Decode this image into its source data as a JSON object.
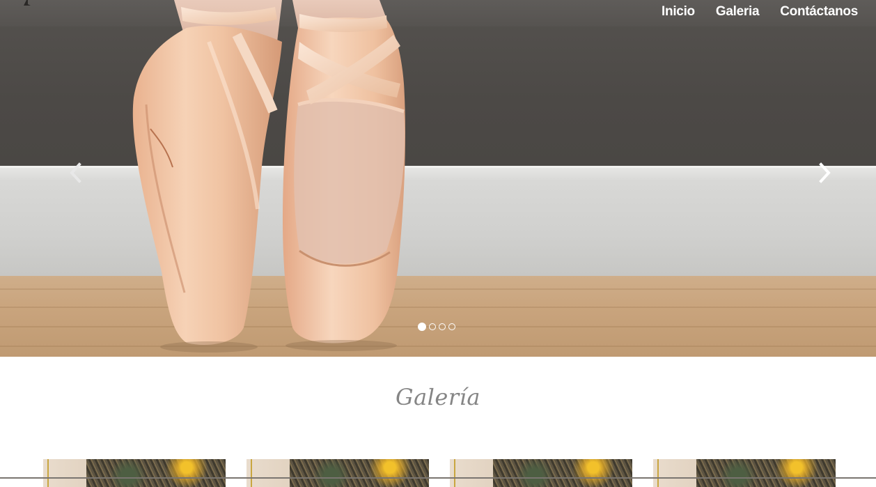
{
  "nav": {
    "items": [
      {
        "label": "Inicio"
      },
      {
        "label": "Galeria"
      },
      {
        "label": "Contáctanos"
      }
    ]
  },
  "carousel": {
    "slide_count": 4,
    "active_index": 0,
    "prev_icon": "chevron-left-icon",
    "next_icon": "chevron-right-icon"
  },
  "gallery": {
    "title": "Galería",
    "thumbnail_count": 4
  },
  "colors": {
    "nav_text": "#ffffff",
    "section_title": "#858585",
    "page_background": "#ffffff"
  }
}
